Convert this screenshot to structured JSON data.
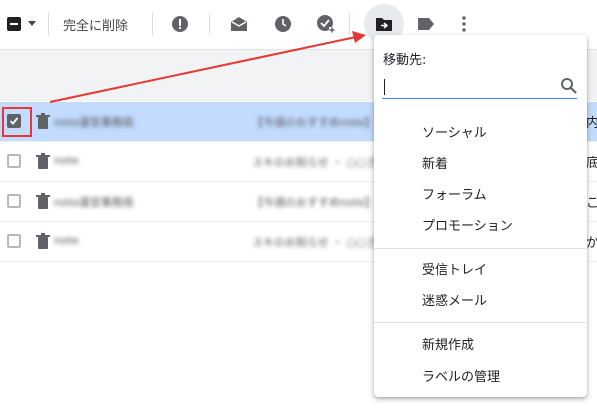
{
  "toolbar": {
    "delete_forever_label": "完全に削除",
    "icons": [
      "select-all-checkbox",
      "select-dropdown-caret",
      "report-spam-icon",
      "mark-read-icon",
      "snooze-icon",
      "add-task-icon",
      "move-to-icon",
      "label-icon",
      "more-vert-icon"
    ]
  },
  "rows": [
    {
      "sender": "note運営事務局",
      "subject": "【今週のおすすめnote】",
      "tail": "内",
      "selected": true
    },
    {
      "sender": "note",
      "subject": "スキのお知らせ ・ ○○さん",
      "tail": "底",
      "selected": false
    },
    {
      "sender": "note運営事務局",
      "subject": "【今週のおすすめnote】",
      "tail": "こ",
      "selected": false
    },
    {
      "sender": "note",
      "subject": "スキのお知らせ ・ ○○さん",
      "tail": "か",
      "selected": false
    }
  ],
  "move_menu": {
    "header": "移動先:",
    "search_placeholder": "",
    "items": [
      "ソーシャル",
      "新着",
      "フォーラム",
      "プロモーション",
      "受信トレイ",
      "迷惑メール",
      "新規作成",
      "ラベルの管理"
    ]
  },
  "colors": {
    "selected_row": "#c2dbff",
    "annotation_red": "#e53935",
    "search_underline": "#4285f4"
  }
}
